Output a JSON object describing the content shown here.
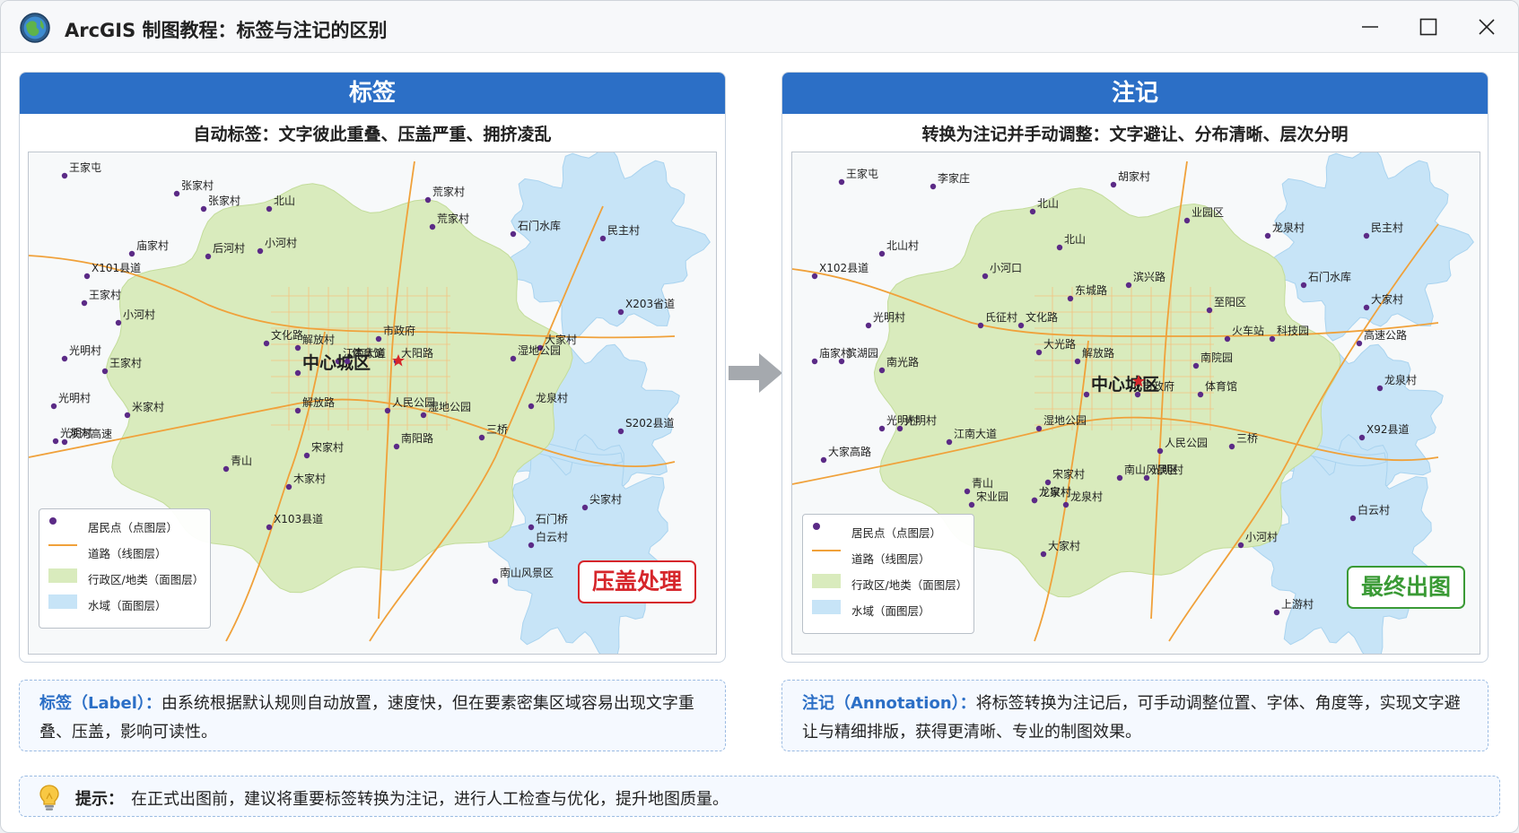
{
  "window": {
    "title": "ArcGIS 制图教程：标签与注记的区别",
    "logo_icon": "arcgis-globe-icon",
    "controls": [
      "minimize-icon",
      "maximize-icon",
      "close-icon"
    ]
  },
  "colors": {
    "header_blue": "#2c6fc6",
    "admin_green": "#d9ebbd",
    "water_blue": "#c7e4f7",
    "road_orange": "#f0a13a",
    "settlement_purple": "#5b2a86",
    "stamp_red": "#d6262b",
    "stamp_green": "#3a9a35"
  },
  "legend": [
    {
      "label": "居民点（点图层）",
      "symbol": "point"
    },
    {
      "label": "道路（线图层）",
      "symbol": "line"
    },
    {
      "label": "行政区/地类（面图层）",
      "symbol": "polygon-green"
    },
    {
      "label": "水域（面图层）",
      "symbol": "polygon-blue"
    }
  ],
  "left": {
    "header": "标签",
    "subtitle": "自动标签：文字彼此重叠、压盖严重、拥挤凌乱",
    "stamp": "压盖处理",
    "labels": [
      "王家屯",
      "张家村",
      "张家村",
      "北山",
      "小河村",
      "后河村",
      "庙家村",
      "X101县道",
      "王家村",
      "小河村",
      "王家村",
      "光明村",
      "光明村",
      "米家村",
      "光明村",
      "滨河高速",
      "X103县道",
      "青山",
      "木家村",
      "宋家村",
      "荒家村",
      "荒家村",
      "石门水库",
      "民主村",
      "X203省道",
      "大家村",
      "湿地公园",
      "龙泉村",
      "S202县道",
      "三桥",
      "石门桥",
      "白云村",
      "尖家村",
      "南山风景区",
      "南阳路",
      "江南大道",
      "解放路",
      "中心城区",
      "体育馆",
      "大阳路",
      "市政府",
      "人民公园",
      "湿地公园",
      "解放村",
      "文化路"
    ],
    "desc_head": "标签（Label）：",
    "desc_text": "由系统根据默认规则自动放置，速度快，但在要素密集区域容易出现文字重叠、压盖，影响可读性。"
  },
  "right": {
    "header": "注记",
    "subtitle": "转换为注记并手动调整：文字避让、分布清晰、层次分明",
    "stamp": "最终出图",
    "labels": [
      "王家屯",
      "李家庄",
      "胡家村",
      "北山",
      "北山",
      "北山村",
      "X102县道",
      "小河口",
      "业园区",
      "龙泉村",
      "民主村",
      "石门水库",
      "大家村",
      "高速公路",
      "龙泉村",
      "X92县道",
      "三桥",
      "白云村",
      "小河村",
      "上游村",
      "石河宿道",
      "大家村",
      "南山风景区",
      "人民公园",
      "湿地公园",
      "江南大道",
      "光明村",
      "光明村",
      "大家高路",
      "光明村",
      "庙家村",
      "氏征村",
      "文化路",
      "大光路",
      "解放路",
      "中心城区",
      "市政府",
      "体育馆",
      "科技园",
      "火车站",
      "东城路",
      "滨兴路",
      "至阳区",
      "南院园",
      "南光路",
      "滨湖园",
      "光明村",
      "龙泉村",
      "宋业园",
      "龙家村",
      "宋家村",
      "青山",
      "龙泉村"
    ],
    "desc_head": "注记（Annotation）：",
    "desc_text": "将标签转换为注记后，可手动调整位置、字体、角度等，实现文字避让与精细排版，获得更清晰、专业的制图效果。"
  },
  "tip": {
    "icon": "lightbulb-icon",
    "head": "提示：",
    "text": "在正式出图前，建议将重要标签转换为注记，进行人工检查与优化，提升地图质量。"
  },
  "arrow_icon": "right-arrow-icon"
}
